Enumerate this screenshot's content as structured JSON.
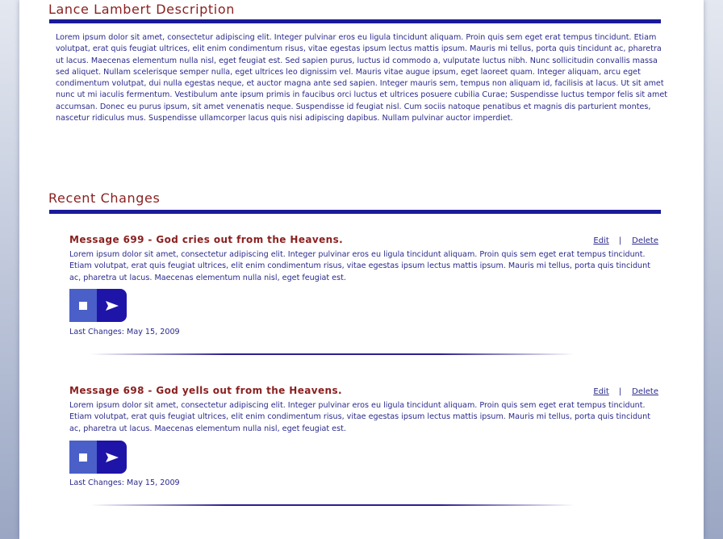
{
  "description": {
    "title": "Lance Lambert Description",
    "text": "Lorem ipsum dolor sit amet, consectetur adipiscing elit. Integer pulvinar eros eu ligula tincidunt aliquam. Proin quis sem eget erat tempus tincidunt. Etiam volutpat, erat quis feugiat ultrices, elit enim condimentum risus, vitae egestas ipsum lectus mattis ipsum. Mauris mi tellus, porta quis tincidunt ac, pharetra ut lacus. Maecenas elementum nulla nisl, eget feugiat est. Sed sapien purus, luctus id commodo a, vulputate luctus nibh. Nunc sollicitudin convallis massa sed aliquet. Nullam scelerisque semper nulla, eget ultrices leo dignissim vel. Mauris vitae augue ipsum, eget laoreet quam. Integer aliquam, arcu eget condimentum volutpat, dui nulla egestas neque, et auctor magna ante sed sapien. Integer mauris sem, tempus non aliquam id, facilisis at lacus. Ut sit amet nunc ut mi iaculis fermentum. Vestibulum ante ipsum primis in faucibus orci luctus et ultrices posuere cubilia Curae; Suspendisse luctus tempor felis sit amet accumsan. Donec eu purus ipsum, sit amet venenatis neque. Suspendisse id feugiat nisl. Cum sociis natoque penatibus et magnis dis parturient montes, nascetur ridiculus mus. Suspendisse ullamcorper lacus quis nisi adipiscing dapibus. Nullam pulvinar auctor imperdiet."
  },
  "recent": {
    "title": "Recent Changes",
    "messages": [
      {
        "title": "Message 699 - God cries out from the Heavens.",
        "edit_label": "Edit",
        "separator": "|",
        "delete_label": "Delete",
        "body": "Lorem ipsum dolor sit amet, consectetur adipiscing elit. Integer pulvinar eros eu ligula tincidunt aliquam. Proin quis sem eget erat tempus tincidunt. Etiam volutpat, erat quis feugiat ultrices, elit enim condimentum risus, vitae egestas ipsum lectus mattis ipsum. Mauris mi tellus, porta quis tincidunt ac, pharetra ut lacus. Maecenas elementum nulla nisl, eget feugiat est.",
        "last_changes": "Last Changes: May 15, 2009"
      },
      {
        "title": "Message 698 - God yells out from the Heavens.",
        "edit_label": "Edit",
        "separator": "|",
        "delete_label": "Delete",
        "body": "Lorem ipsum dolor sit amet, consectetur adipiscing elit. Integer pulvinar eros eu ligula tincidunt aliquam. Proin quis sem eget erat tempus tincidunt. Etiam volutpat, erat quis feugiat ultrices, elit enim condimentum risus, vitae egestas ipsum lectus mattis ipsum. Mauris mi tellus, porta quis tincidunt ac, pharetra ut lacus. Maecenas elementum nulla nisl, eget feugiat est.",
        "last_changes": "Last Changes: May 15, 2009"
      }
    ]
  },
  "icons": {
    "stop": "stop-icon",
    "play": "play-arrow-icon"
  },
  "colors": {
    "title_red": "#8a1f1f",
    "rule_blue": "#1a1a9a",
    "text_blue": "#2a2a8c",
    "stop_button": "#4a5fc8",
    "play_button": "#1f14a8"
  }
}
